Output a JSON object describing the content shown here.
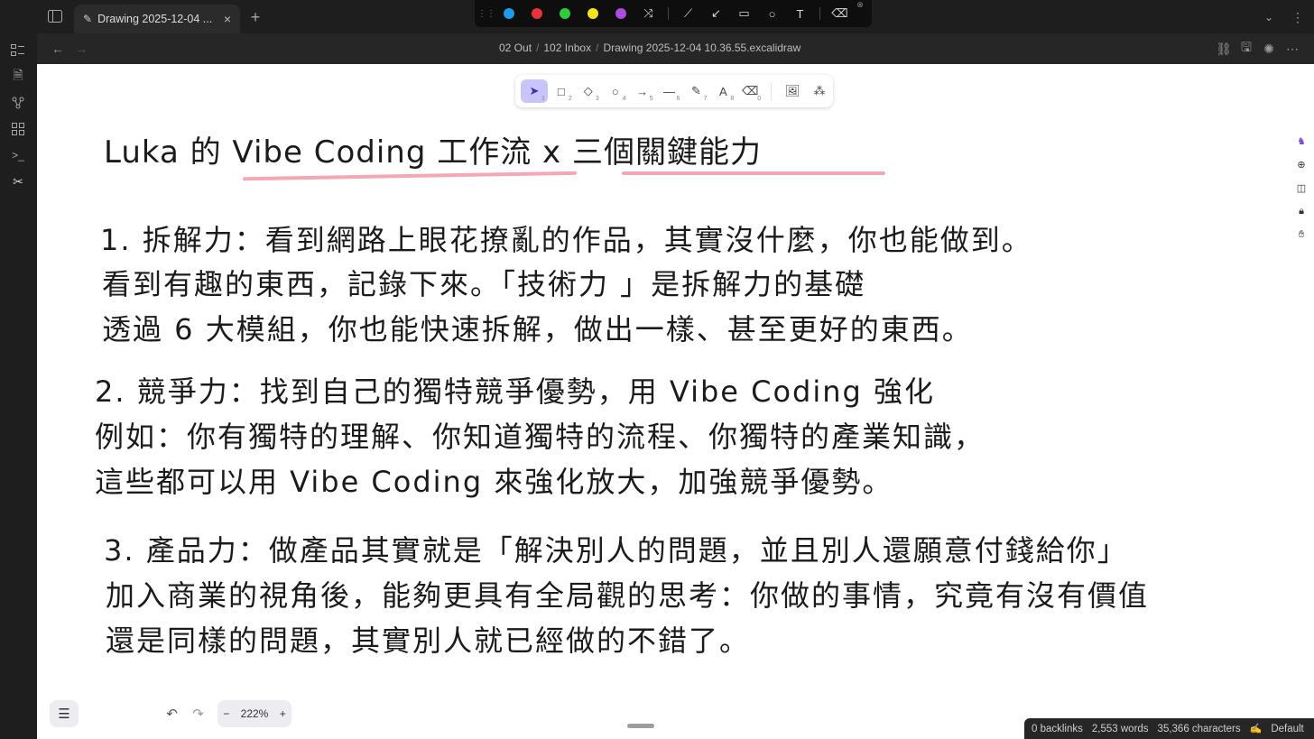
{
  "tab": {
    "title": "Drawing 2025-12-04 ...",
    "close": "×",
    "new": "+"
  },
  "color_toolbar": {
    "colors": [
      "#1e9be8",
      "#e8323c",
      "#2ecb3c",
      "#f4e21a",
      "#a94ddb"
    ]
  },
  "breadcrumb": {
    "part1": "02 Out",
    "part2": "102 Inbox",
    "part3": "Drawing 2025-12-04 10.36.55.excalidraw",
    "sep": "/"
  },
  "excalidraw_tools": {
    "keys": [
      "1",
      "2",
      "3",
      "4",
      "5",
      "6",
      "7",
      "8",
      "0"
    ]
  },
  "drawing": {
    "title": "Luka 的 Vibe Coding 工作流 x 三個關鍵能力",
    "section1": [
      "1. 拆解力：看到網路上眼花撩亂的作品，其實沒什麼，你也能做到。",
      "看到有趣的東西，記錄下來。「技術力 」是拆解力的基礎",
      "透過 6 大模組，你也能快速拆解，做出一樣、甚至更好的東西。"
    ],
    "section2": [
      "2. 競爭力：找到自己的獨特競爭優勢，用 Vibe Coding 強化",
      "例如：你有獨特的理解、你知道獨特的流程、你獨特的產業知識，",
      "這些都可以用 Vibe Coding 來強化放大，加強競爭優勢。"
    ],
    "section3": [
      "3. 產品力：做產品其實就是「解決別人的問題，並且別人還願意付錢給你」",
      "加入商業的視角後，能夠更具有全局觀的思考：你做的事情，究竟有沒有價值",
      "還是同樣的問題，其實別人就已經做的不錯了。"
    ],
    "underline_color": "#f4a7b4"
  },
  "zoom": {
    "level": "222%",
    "minus": "−",
    "plus": "+"
  },
  "status": {
    "backlinks": "0 backlinks",
    "words": "2,553 words",
    "characters": "35,366 characters",
    "mode": "Default"
  }
}
